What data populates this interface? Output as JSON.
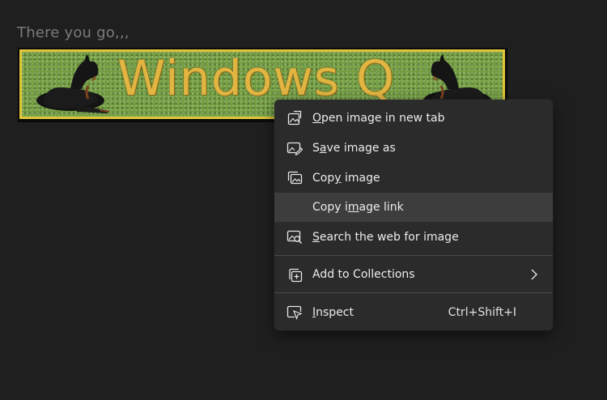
{
  "post": {
    "text": "There you go,,,"
  },
  "banner": {
    "title": "Windows Q"
  },
  "context_menu": {
    "items": [
      {
        "pre": "",
        "mn": "O",
        "post": "pen image in new tab",
        "icon": "open-image-icon"
      },
      {
        "pre": "S",
        "mn": "a",
        "post": "ve image as",
        "icon": "save-image-icon"
      },
      {
        "pre": "Cop",
        "mn": "y",
        "post": " image",
        "icon": "copy-image-icon"
      },
      {
        "pre": "Copy i",
        "mn": "m",
        "post": "age link",
        "icon": "none"
      },
      {
        "pre": "",
        "mn": "S",
        "post": "earch the web for image",
        "icon": "visual-search-icon"
      },
      {
        "pre": "Add to Collections",
        "mn": "",
        "post": "",
        "icon": "collections-icon"
      },
      {
        "pre": "",
        "mn": "I",
        "post": "nspect",
        "shortcut": "Ctrl+Shift+I",
        "icon": "inspect-icon"
      }
    ]
  },
  "colors": {
    "page_bg": "#1f1f1f",
    "menu_bg": "#2b2b2b",
    "hover_bg": "#3d3d3d",
    "banner_text": "#e2b542",
    "banner_border": "#e1c53a",
    "grass": "#6f9a3e"
  }
}
